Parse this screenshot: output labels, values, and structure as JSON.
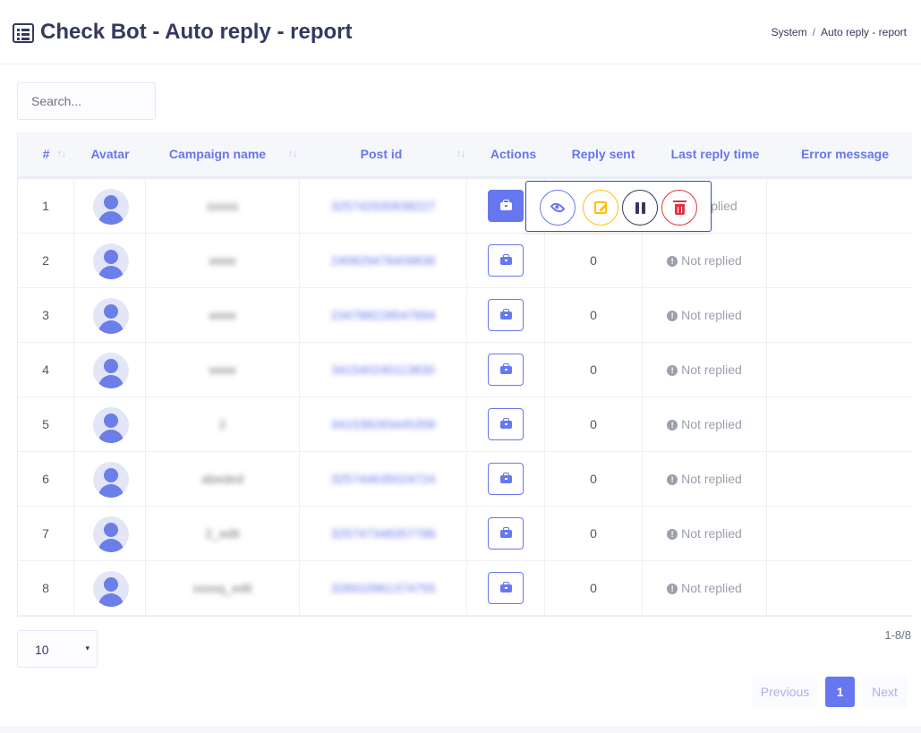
{
  "header": {
    "title": "Check Bot - Auto reply - report",
    "breadcrumb": [
      "System",
      "Auto reply - report"
    ],
    "breadcrumb_sep": "/"
  },
  "search": {
    "placeholder": "Search..."
  },
  "table": {
    "columns": [
      "#",
      "Avatar",
      "Campaign name",
      "Post id",
      "Actions",
      "Reply sent",
      "Last reply time",
      "Error message"
    ],
    "sort_glyph": "↑↓",
    "rows": [
      {
        "num": "1",
        "campaign": "sssss",
        "post_id": "325742930838227",
        "reply_sent": "",
        "last_reply": "Not replied"
      },
      {
        "num": "2",
        "campaign": "www",
        "post_id": "240829478409836",
        "reply_sent": "0",
        "last_reply": "Not replied"
      },
      {
        "num": "3",
        "campaign": "www",
        "post_id": "234788228547894",
        "reply_sent": "0",
        "last_reply": "Not replied"
      },
      {
        "num": "4",
        "campaign": "www",
        "post_id": "341540240113830",
        "reply_sent": "0",
        "last_reply": "Not replied"
      },
      {
        "num": "5",
        "campaign": "2",
        "post_id": "341538283445358",
        "reply_sent": "0",
        "last_reply": "Not replied"
      },
      {
        "num": "6",
        "campaign": "abeded",
        "post_id": "325744635024724",
        "reply_sent": "0",
        "last_reply": "Not replied"
      },
      {
        "num": "7",
        "campaign": "2_edit",
        "post_id": "325747348357786",
        "reply_sent": "0",
        "last_reply": "Not replied"
      },
      {
        "num": "8",
        "campaign": "ssssq_edit",
        "post_id": "328910961374755",
        "reply_sent": "0",
        "last_reply": "Not replied"
      }
    ],
    "row1_partial_status": "eplied"
  },
  "action_popup": {
    "buttons": [
      "eye-icon",
      "edit-icon",
      "pause-icon",
      "trash-icon"
    ]
  },
  "footer": {
    "page_size": "10",
    "page_size_caret": "▾",
    "count": "1-8/8",
    "prev": "Previous",
    "page": "1",
    "next": "Next"
  },
  "colors": {
    "accent": "#6777ef",
    "warning": "#ffc107",
    "danger": "#dc3545",
    "dark": "#34395e"
  }
}
